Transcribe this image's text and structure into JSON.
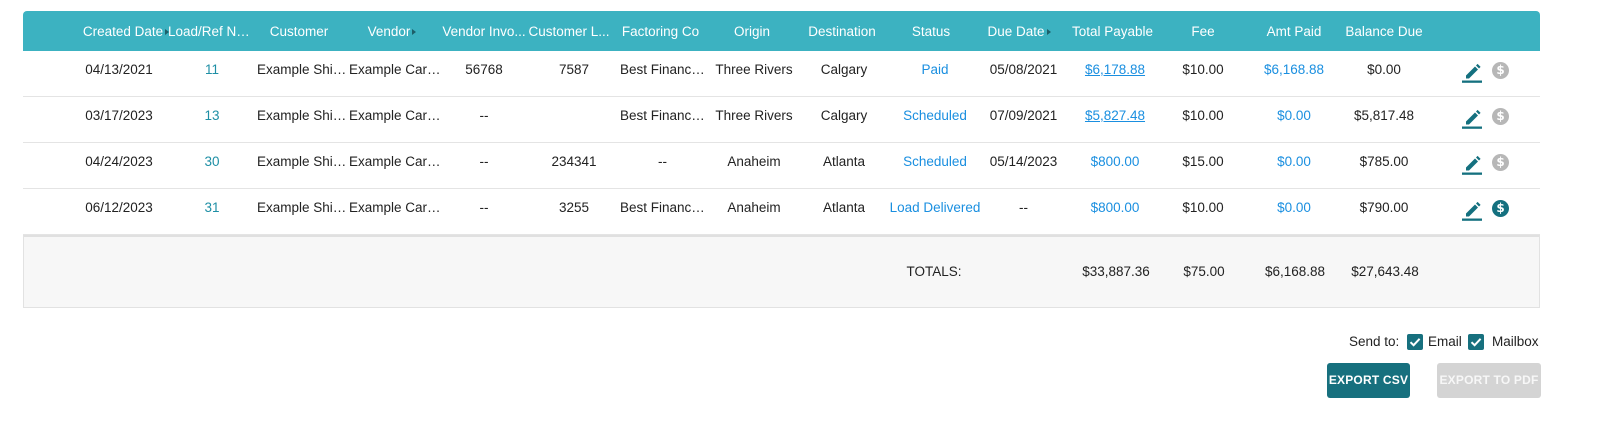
{
  "table": {
    "columns": [
      {
        "label": "Created Date",
        "sort": "right"
      },
      {
        "label": "Load/Ref Nbr",
        "sort": "up"
      },
      {
        "label": "Customer",
        "sort": ""
      },
      {
        "label": "Vendor",
        "sort": "right"
      },
      {
        "label": "Vendor Invo...",
        "sort": ""
      },
      {
        "label": "Customer L...",
        "sort": ""
      },
      {
        "label": "Factoring Co",
        "sort": ""
      },
      {
        "label": "Origin",
        "sort": ""
      },
      {
        "label": "Destination",
        "sort": ""
      },
      {
        "label": "Status",
        "sort": ""
      },
      {
        "label": "Due Date",
        "sort": "right"
      },
      {
        "label": "Total Payable",
        "sort": ""
      },
      {
        "label": "Fee",
        "sort": ""
      },
      {
        "label": "Amt Paid",
        "sort": ""
      },
      {
        "label": "Balance Due",
        "sort": ""
      }
    ],
    "rows": [
      {
        "created": "04/13/2021",
        "load": "11",
        "customer": "Example Shipper",
        "vendor": "Example Carrier",
        "vendor_invoice": "56768",
        "customer_load": "7587",
        "factoring": "Best Financing",
        "origin": "Three Rivers",
        "destination": "Calgary",
        "status": "Paid",
        "due": "05/08/2021",
        "total_payable": "$6,178.88",
        "fee": "$10.00",
        "amt_paid": "$6,168.88",
        "balance_due": "$0.00",
        "payment_icon": "inactive"
      },
      {
        "created": "03/17/2023",
        "load": "13",
        "customer": "Example Shipper",
        "vendor": "Example Carrier",
        "vendor_invoice": "--",
        "customer_load": "",
        "factoring": "Best Financing",
        "origin": "Three Rivers",
        "destination": "Calgary",
        "status": "Scheduled",
        "due": "07/09/2021",
        "total_payable": "$5,827.48",
        "fee": "$10.00",
        "amt_paid": "$0.00",
        "balance_due": "$5,817.48",
        "payment_icon": "inactive"
      },
      {
        "created": "04/24/2023",
        "load": "30",
        "customer": "Example Shipper",
        "vendor": "Example Carrier",
        "vendor_invoice": "--",
        "customer_load": "234341",
        "factoring": "--",
        "origin": "Anaheim",
        "destination": "Atlanta",
        "status": "Scheduled",
        "due": "05/14/2023",
        "total_payable": "$800.00",
        "fee": "$15.00",
        "amt_paid": "$0.00",
        "balance_due": "$785.00",
        "payment_icon": "inactive"
      },
      {
        "created": "06/12/2023",
        "load": "31",
        "customer": "Example Shipper",
        "vendor": "Example Carrier",
        "vendor_invoice": "--",
        "customer_load": "3255",
        "factoring": "Best Financing",
        "origin": "Anaheim",
        "destination": "Atlanta",
        "status": "Load Delivered",
        "due": "--",
        "total_payable": "$800.00",
        "fee": "$10.00",
        "amt_paid": "$0.00",
        "balance_due": "$790.00",
        "payment_icon": "active"
      }
    ],
    "totals": {
      "label": "TOTALS:",
      "total_payable": "$33,887.36",
      "fee": "$75.00",
      "amt_paid": "$6,168.88",
      "balance_due": "$27,643.48"
    }
  },
  "row_icons": {
    "edit": "pencil-icon",
    "pay": "dollar-icon",
    "dollar_glyph": "$"
  },
  "send_to": {
    "label": "Send to:",
    "email_label": "Email",
    "email_checked": true,
    "mailbox_label": "Mailbox",
    "mailbox_checked": true
  },
  "actions": {
    "export_csv": "EXPORT CSV",
    "export_pdf": "EXPORT TO PDF"
  },
  "colors": {
    "header": "#3cb2c1",
    "accent": "#17707e",
    "link": "#1a8fe0",
    "disabled": "#d4d4d4"
  }
}
